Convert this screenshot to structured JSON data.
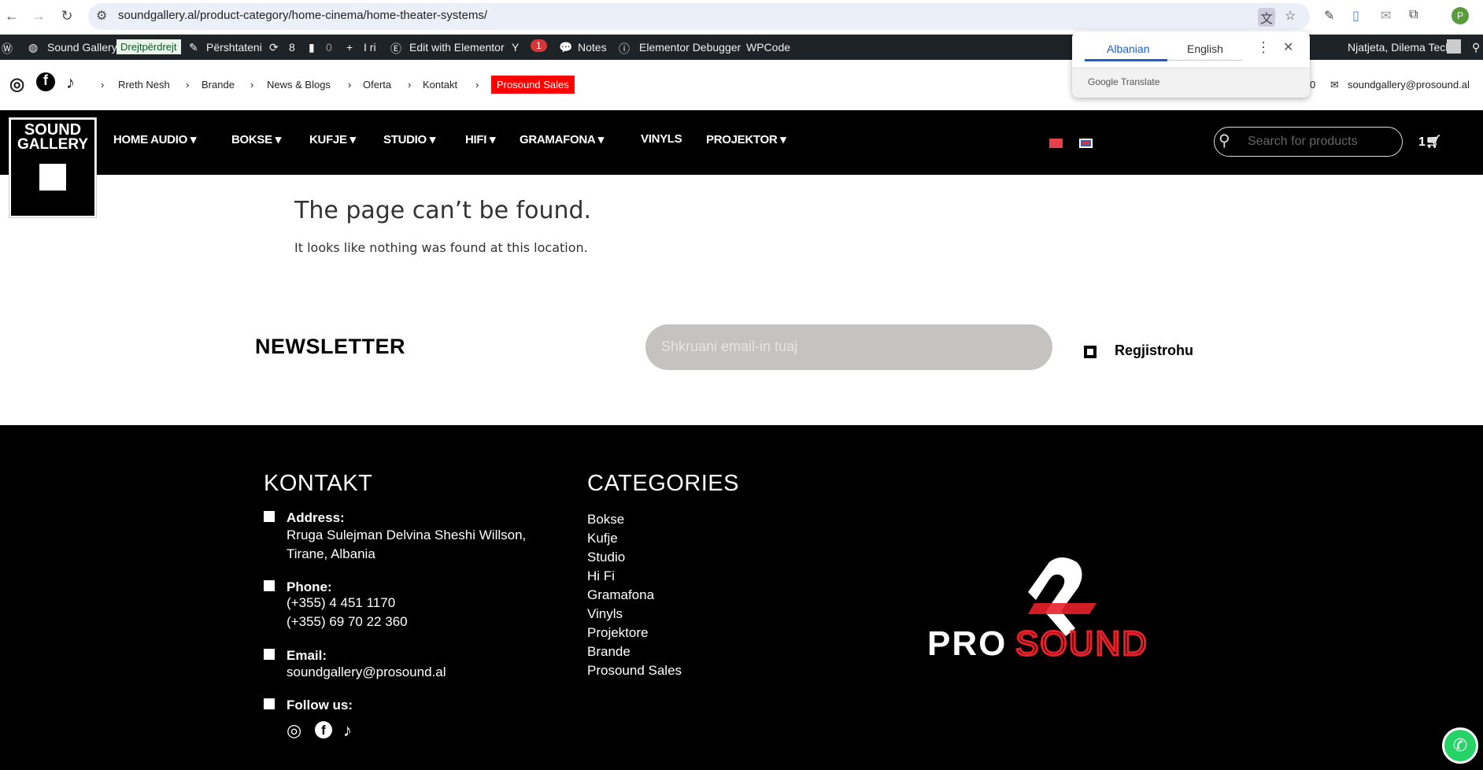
{
  "browser": {
    "url": "soundgallery.al/product-category/home-cinema/home-theater-systems/",
    "profile_initial": "P"
  },
  "admin_bar": {
    "site": "Sound Gallery",
    "live": "Drejtpërdrejt",
    "customize": "Përshtateni",
    "updates": "8",
    "comments": "0",
    "new": "I ri",
    "elementor": "Edit with Elementor",
    "yoast_count": "1",
    "notes": "Notes",
    "debugger": "Elementor Debugger",
    "wpcode": "WPCode",
    "greeting": "Njatjeta, Dilema Tech"
  },
  "translate_popup": {
    "tabs": [
      "Albanian",
      "English"
    ],
    "active": "Albanian",
    "brand": "Google Translate"
  },
  "top_bar": {
    "breadcrumbs": [
      "Rreth Nesh",
      "Brande",
      "News & Blogs",
      "Oferta",
      "Kontakt"
    ],
    "sales": "Prosound Sales",
    "phone_fragment": "0",
    "email": "soundgallery@prosound.al"
  },
  "logo": {
    "line1": "SOUND",
    "line2": "GALLERY"
  },
  "nav": {
    "items": [
      {
        "label": "HOME AUDIO",
        "dropdown": true
      },
      {
        "label": "BOKSE",
        "dropdown": true
      },
      {
        "label": "KUFJE",
        "dropdown": true
      },
      {
        "label": "STUDIO",
        "dropdown": true
      },
      {
        "label": "HIFI",
        "dropdown": true
      },
      {
        "label": "GRAMAFONA",
        "dropdown": true
      },
      {
        "label": "VINYLS",
        "dropdown": false
      },
      {
        "label": "PROJEKTOR",
        "dropdown": true
      }
    ],
    "search_placeholder": "Search for products",
    "cart_count": "1"
  },
  "main": {
    "title": "The page can’t be found.",
    "message": "It looks like nothing was found at this location."
  },
  "newsletter": {
    "title": "NEWSLETTER",
    "placeholder": "Shkruani email-in tuaj",
    "button": "Regjistrohu"
  },
  "footer": {
    "kontakt_title": "KONTAKT",
    "address_label": "Address:",
    "address_lines": [
      "Rruga Sulejman Delvina Sheshi Willson,",
      "Tirane, Albania"
    ],
    "phone_label": "Phone:",
    "phones": [
      "(+355) 4 451 1170",
      "(+355) 69 70 22 360"
    ],
    "email_label": "Email:",
    "email": "soundgallery@prosound.al",
    "follow_label": "Follow us:",
    "categories_title": "CATEGORIES",
    "categories": [
      "Bokse",
      "Kufje",
      "Studio",
      "Hi Fi",
      "Gramafona",
      "Vinyls",
      "Projektore",
      "Brande",
      "Prosound Sales"
    ],
    "brand_logo": "PROSOUND"
  },
  "colors": {
    "accent_red": "#ff0000",
    "footer_bg": "#000000",
    "whatsapp": "#25d366"
  }
}
